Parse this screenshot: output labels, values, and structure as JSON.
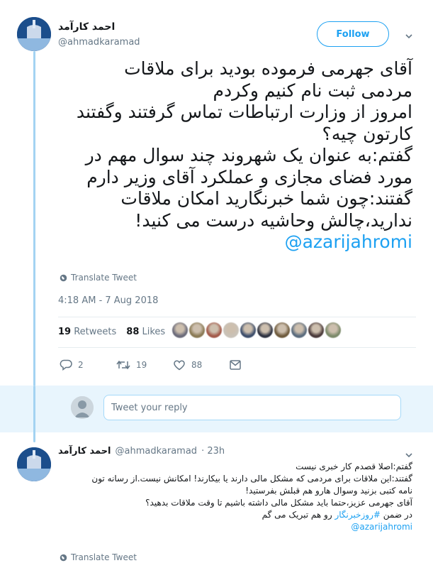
{
  "main_tweet": {
    "author_name": "احمد کارآمد",
    "author_handle": "@ahmadkaramad",
    "follow_label": "Follow",
    "text_lines": [
      "آقای جهرمی فرموده بودید برای ملاقات",
      "مردمی ثبت نام کنیم وکردم",
      "امروز از وزارت ارتباطات تماس گرفتند وگفتند",
      "کارتون چیه؟",
      "گفتم:به عنوان یک شهروند چند سوال مهم در",
      "مورد فضای مجازی و عملکرد آقای وزیر دارم",
      "گفتند:چون شما خبرنگارید امکان ملاقات",
      "ندارید،چالش وحاشیه درست می کنید!"
    ],
    "mention": "@azarijahromi",
    "translate_label": "Translate Tweet",
    "timestamp": "4:18 AM - 7 Aug 2018",
    "retweets_count": "19",
    "retweets_label": "Retweets",
    "likes_count": "88",
    "likes_label": "Likes",
    "liker_colors": [
      "#6b6b7a",
      "#8a7a55",
      "#a35a4a",
      "#c9c2b8",
      "#3d4e6b",
      "#2e3240",
      "#6e5a3c",
      "#5a6b7d",
      "#4a3a3a",
      "#7c8a6a"
    ],
    "reply_count": "2",
    "retweet_action_count": "19",
    "like_action_count": "88"
  },
  "reply_box": {
    "placeholder": "Tweet your reply"
  },
  "reply_tweet": {
    "author_name": "احمد کارآمد",
    "author_handle": "@ahmadkaramad",
    "time": "· 23h",
    "lines": [
      "گفتم:اصلا قصدم کار خبری نیست",
      "گفتند:این ملاقات برای مردمی که مشکل مالی دارند یا بیکارند! امکانش نیست.از رسانه تون",
      "نامه کتبی بزنید وسوال هارو هم قبلش بفرستید!",
      "آقای جهرمی عزیز،حتما باید مشکل مالی داشته باشیم تا وقت ملاقات بدهید؟"
    ],
    "last_line_pre": "در ضمن ",
    "hashtag": "#روزخبرنگار",
    "last_line_post": " رو هم تبریک می گم",
    "mention": "@azarijahromi",
    "translate_label": "Translate Tweet"
  },
  "colors": {
    "accent": "#1da1f2",
    "thread": "#a3d3f2",
    "reply_bg": "#e8f5fd"
  }
}
